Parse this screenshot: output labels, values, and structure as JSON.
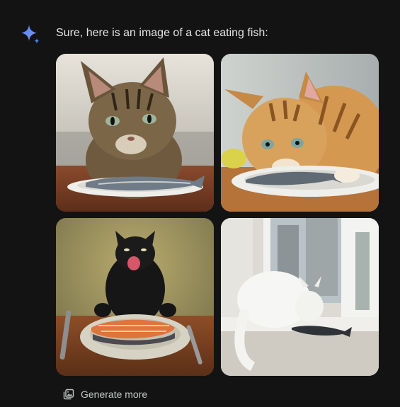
{
  "response": {
    "message": "Sure, here is an image of a cat eating fish:",
    "avatar_icon": "gemini-sparkle-icon",
    "images": [
      {
        "subject": "tabby-cat-eating-fish",
        "icon": "image"
      },
      {
        "subject": "orange-cat-eating-fish",
        "icon": "image"
      },
      {
        "subject": "black-cat-with-salmon",
        "icon": "image"
      },
      {
        "subject": "white-cat-at-window-with-fish",
        "icon": "image"
      }
    ],
    "generate_more_label": "Generate more",
    "generate_more_icon": "image-stack-icon"
  },
  "colors": {
    "background": "#131314",
    "text": "#e3e3e3",
    "secondary_text": "#c4c7c5",
    "sparkle_blue": "#4e86f6",
    "sparkle_purple": "#9b72cb"
  }
}
